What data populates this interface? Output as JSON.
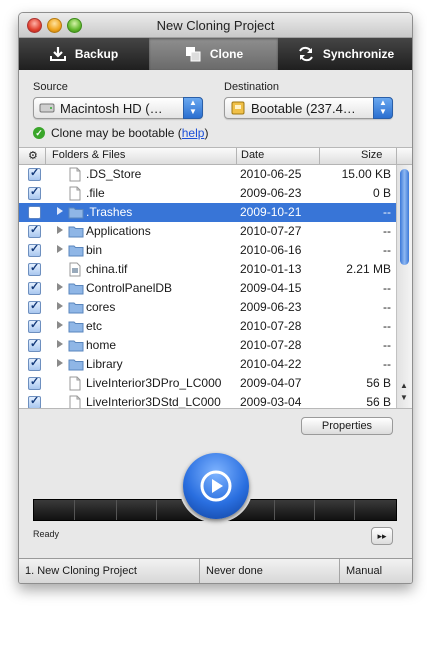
{
  "window": {
    "title": "New Cloning Project"
  },
  "toolbar": {
    "tabs": [
      {
        "label": "Backup",
        "icon": "download-icon",
        "active": false
      },
      {
        "label": "Clone",
        "icon": "clone-icon",
        "active": true
      },
      {
        "label": "Synchronize",
        "icon": "sync-icon",
        "active": false
      }
    ]
  },
  "source": {
    "label": "Source",
    "value": "Macintosh HD (…",
    "icon": "hard-drive-icon"
  },
  "destination": {
    "label": "Destination",
    "value": "Bootable (237.4…",
    "icon": "external-drive-icon"
  },
  "bootable": {
    "message": "Clone may be bootable (",
    "link": "help",
    "close": ")"
  },
  "table": {
    "headers": {
      "check": "⚙",
      "name": "Folders & Files",
      "date": "Date",
      "size": "Size"
    },
    "rows": [
      {
        "checked": true,
        "expandable": false,
        "icon": "file-icon",
        "name": ".DS_Store",
        "date": "2010-06-25",
        "size": "15.00 KB",
        "selected": false
      },
      {
        "checked": true,
        "expandable": false,
        "icon": "file-icon",
        "name": ".file",
        "date": "2009-06-23",
        "size": "0 B",
        "selected": false
      },
      {
        "checked": false,
        "expandable": true,
        "icon": "folder-icon",
        "name": ".Trashes",
        "date": "2009-10-21",
        "size": "--",
        "selected": true
      },
      {
        "checked": true,
        "expandable": true,
        "icon": "folder-icon",
        "name": "Applications",
        "date": "2010-07-27",
        "size": "--",
        "selected": false
      },
      {
        "checked": true,
        "expandable": true,
        "icon": "folder-icon",
        "name": "bin",
        "date": "2010-06-16",
        "size": "--",
        "selected": false
      },
      {
        "checked": true,
        "expandable": false,
        "icon": "image-file-icon",
        "name": "china.tif",
        "date": "2010-01-13",
        "size": "2.21 MB",
        "selected": false
      },
      {
        "checked": true,
        "expandable": true,
        "icon": "folder-icon",
        "name": "ControlPanelDB",
        "date": "2009-04-15",
        "size": "--",
        "selected": false
      },
      {
        "checked": true,
        "expandable": true,
        "icon": "folder-icon",
        "name": "cores",
        "date": "2009-06-23",
        "size": "--",
        "selected": false
      },
      {
        "checked": true,
        "expandable": true,
        "icon": "folder-icon",
        "name": "etc",
        "date": "2010-07-28",
        "size": "--",
        "selected": false
      },
      {
        "checked": true,
        "expandable": true,
        "icon": "folder-icon",
        "name": "home",
        "date": "2010-07-28",
        "size": "--",
        "selected": false
      },
      {
        "checked": true,
        "expandable": true,
        "icon": "folder-icon",
        "name": "Library",
        "date": "2010-04-22",
        "size": "--",
        "selected": false
      },
      {
        "checked": true,
        "expandable": false,
        "icon": "file-icon",
        "name": "LiveInterior3DPro_LC000",
        "date": "2009-04-07",
        "size": "56 B",
        "selected": false
      },
      {
        "checked": true,
        "expandable": false,
        "icon": "file-icon",
        "name": "LiveInterior3DStd_LC000",
        "date": "2009-03-04",
        "size": "56 B",
        "selected": false
      }
    ]
  },
  "buttons": {
    "properties": "Properties",
    "fast_forward": "▸▸"
  },
  "progress": {
    "status": "Ready",
    "fraction": 0
  },
  "statusbar": {
    "project": "1. New Cloning Project",
    "last_run": "Never done",
    "mode": "Manual"
  },
  "colors": {
    "selection": "#3875d7",
    "accent": "#2a6fe0",
    "ok": "#3aa62a"
  }
}
